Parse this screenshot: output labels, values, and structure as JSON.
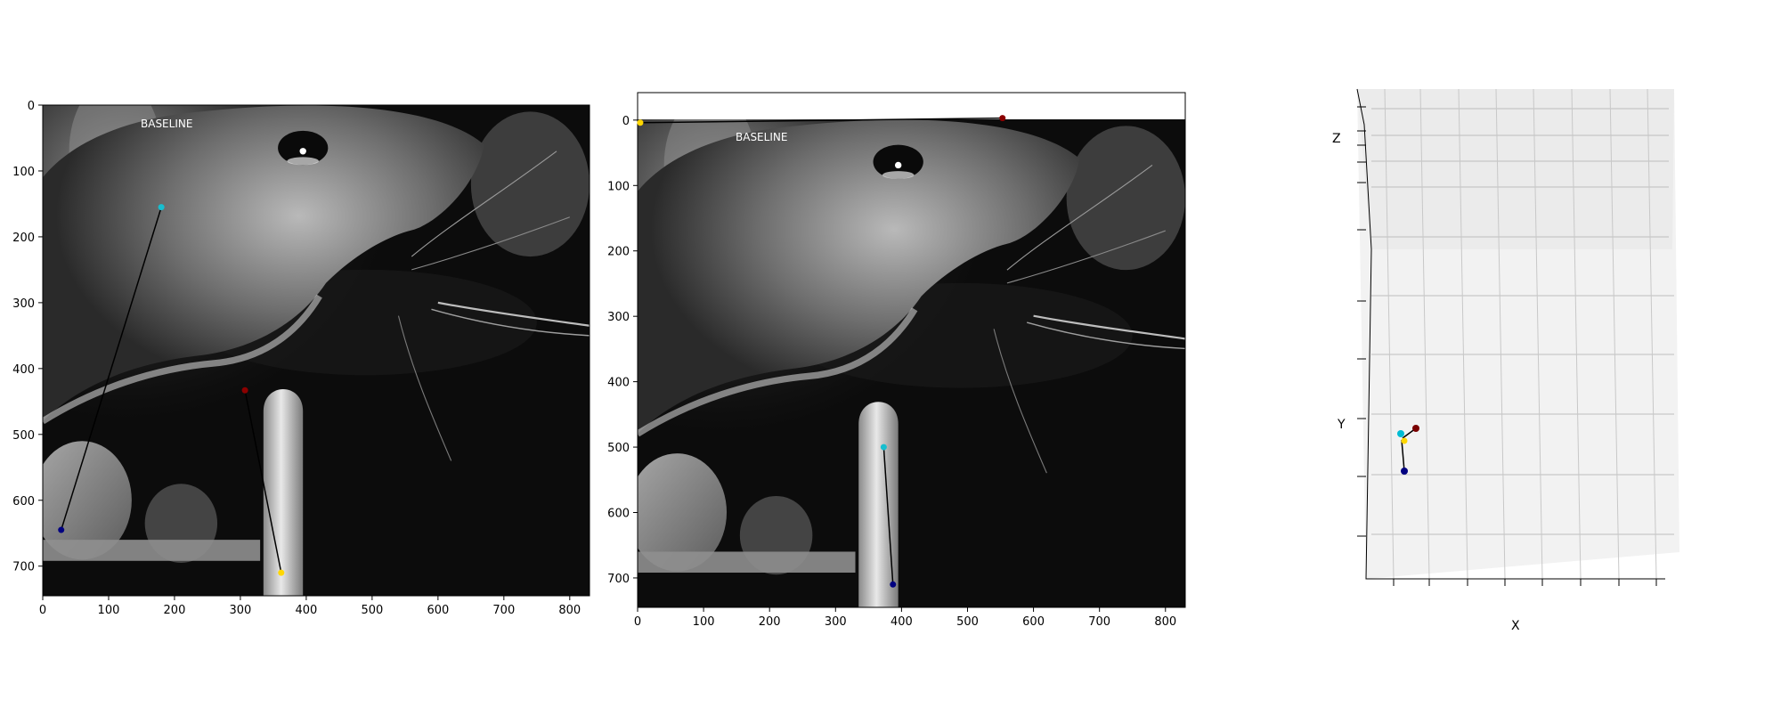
{
  "chart_data": [
    {
      "type": "scatter",
      "panel": "camera-1",
      "overlay_text": "BASELINE",
      "xlim": [
        0,
        830
      ],
      "ylim": [
        745,
        0
      ],
      "xticks": [
        0,
        100,
        200,
        300,
        400,
        500,
        600,
        700,
        800
      ],
      "yticks": [
        0,
        100,
        200,
        300,
        400,
        500,
        600,
        700
      ],
      "points": [
        {
          "x": 180,
          "y": 155,
          "color": "#17becf"
        },
        {
          "x": 28,
          "y": 645,
          "color": "#000080"
        },
        {
          "x": 307,
          "y": 433,
          "color": "#8b0000"
        },
        {
          "x": 362,
          "y": 710,
          "color": "#ffd700"
        }
      ],
      "segments": [
        [
          0,
          1
        ],
        [
          2,
          3
        ]
      ]
    },
    {
      "type": "scatter",
      "panel": "camera-2",
      "overlay_text": "BASELINE",
      "xlim": [
        0,
        830
      ],
      "ylim": [
        745,
        -42
      ],
      "xticks": [
        0,
        100,
        200,
        300,
        400,
        500,
        600,
        700,
        800
      ],
      "yticks": [
        0,
        100,
        200,
        300,
        400,
        500,
        600,
        700
      ],
      "points": [
        {
          "x": 4,
          "y": 4,
          "color": "#ffd700"
        },
        {
          "x": 553,
          "y": -3,
          "color": "#8b0000"
        },
        {
          "x": 373,
          "y": 500,
          "color": "#17becf"
        },
        {
          "x": 387,
          "y": 710,
          "color": "#000080"
        }
      ],
      "segments": [
        [
          0,
          1
        ],
        [
          2,
          3
        ]
      ]
    },
    {
      "type": "scatter3d",
      "panel": "3d-reconstruction",
      "xlabel": "X",
      "ylabel": "Y",
      "zlabel": "Z",
      "points": [
        {
          "label": "cyan",
          "color": "#00bcd4"
        },
        {
          "label": "yellow",
          "color": "#ffd700"
        },
        {
          "label": "red",
          "color": "#7a0000"
        },
        {
          "label": "navy",
          "color": "#000080"
        }
      ]
    }
  ]
}
